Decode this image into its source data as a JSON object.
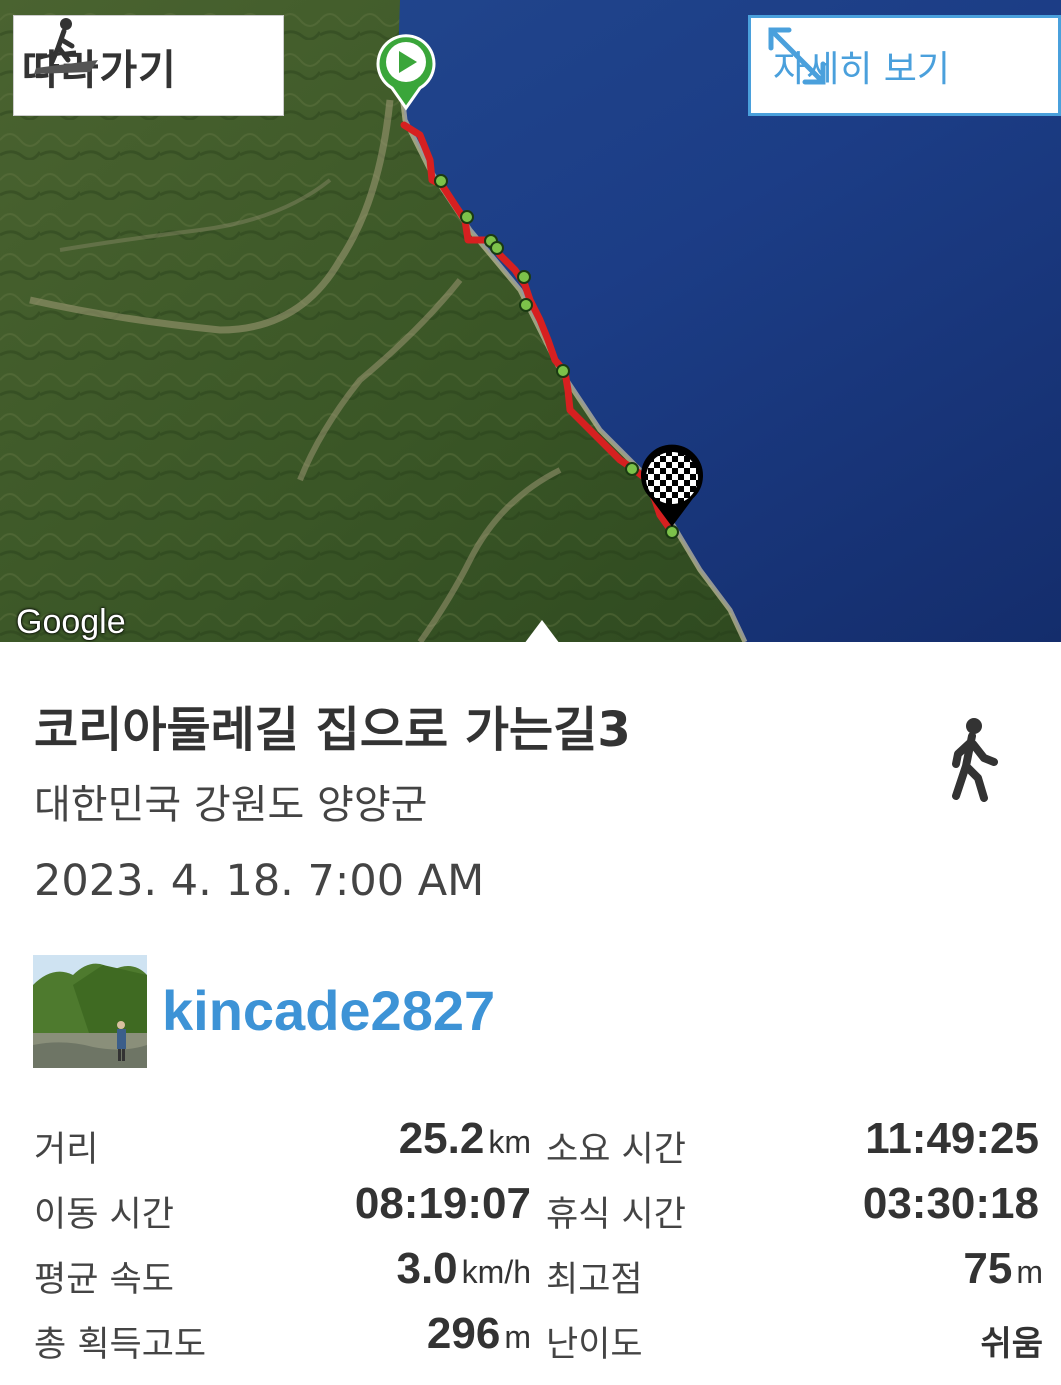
{
  "map": {
    "follow_label": "따라가기",
    "detail_label": "자세히 보기",
    "google_label": "Google"
  },
  "trail": {
    "title": "코리아둘레길 집으로 가는길3",
    "location": "대한민국 강원도 양양군",
    "datetime": "2023. 4. 18. 7:00 AM",
    "activity_icon": "walking-person-icon",
    "username": "kincade2827"
  },
  "stats": {
    "distance": {
      "label": "거리",
      "value": "25.2",
      "unit": "km"
    },
    "total_time": {
      "label": "소요 시간",
      "value": "11:49:25"
    },
    "moving_time": {
      "label": "이동 시간",
      "value": "08:19:07"
    },
    "rest_time": {
      "label": "휴식 시간",
      "value": "03:30:18"
    },
    "avg_speed": {
      "label": "평균 속도",
      "value": "3.0",
      "unit": "km/h"
    },
    "max_elevation": {
      "label": "최고점",
      "value": "75",
      "unit": "m"
    },
    "total_ascent": {
      "label": "총 획득고도",
      "value": "296",
      "unit": "m"
    },
    "difficulty": {
      "label": "난이도",
      "value": "쉬움"
    }
  },
  "colors": {
    "accent": "#4aa0dc",
    "route": "#d62020",
    "sea": "#1d3f8a",
    "land": "#3f5a2a"
  }
}
